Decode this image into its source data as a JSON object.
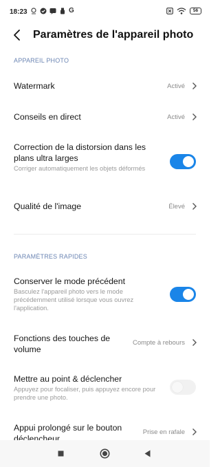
{
  "status_bar": {
    "time": "18:23",
    "battery": "56",
    "left_icons": [
      "location-pin-icon",
      "check-circle-icon",
      "message-icon",
      "usb-icon"
    ],
    "g_letter": "G"
  },
  "header": {
    "title": "Paramètres de l'appareil photo"
  },
  "sections": {
    "camera": {
      "header": "APPAREIL PHOTO",
      "watermark": {
        "title": "Watermark",
        "value": "Activé"
      },
      "live_tips": {
        "title": "Conseils en direct",
        "value": "Activé"
      },
      "distortion": {
        "title": "Correction de la distorsion dans les plans ultra larges",
        "desc": "Corriger automatiquement les objets déformés",
        "enabled": true
      },
      "image_quality": {
        "title": "Qualité de l'image",
        "value": "Élevé"
      }
    },
    "quick": {
      "header": "PARAMÈTRES RAPIDES",
      "keep_mode": {
        "title": "Conserver le mode précédent",
        "desc": "Basculez l'appareil photo vers le mode précédemment utilisé lorsque vous ouvrez l'application.",
        "enabled": true
      },
      "volume_keys": {
        "title": "Fonctions des touches de volume",
        "value": "Compte à rebours"
      },
      "focus_shoot": {
        "title": "Mettre au point & déclencher",
        "desc": "Appuyez pour focaliser, puis appuyez encore pour prendre une photo.",
        "enabled": false
      },
      "long_press": {
        "title": "Appui prolongé sur le bouton déclencheur",
        "value": "Prise en rafale"
      }
    }
  },
  "colors": {
    "accent": "#1a85e8",
    "section_header": "#6b85b3"
  },
  "nav_bar": {
    "icons": [
      "recents-square-icon",
      "home-circle-icon",
      "back-triangle-icon"
    ]
  }
}
